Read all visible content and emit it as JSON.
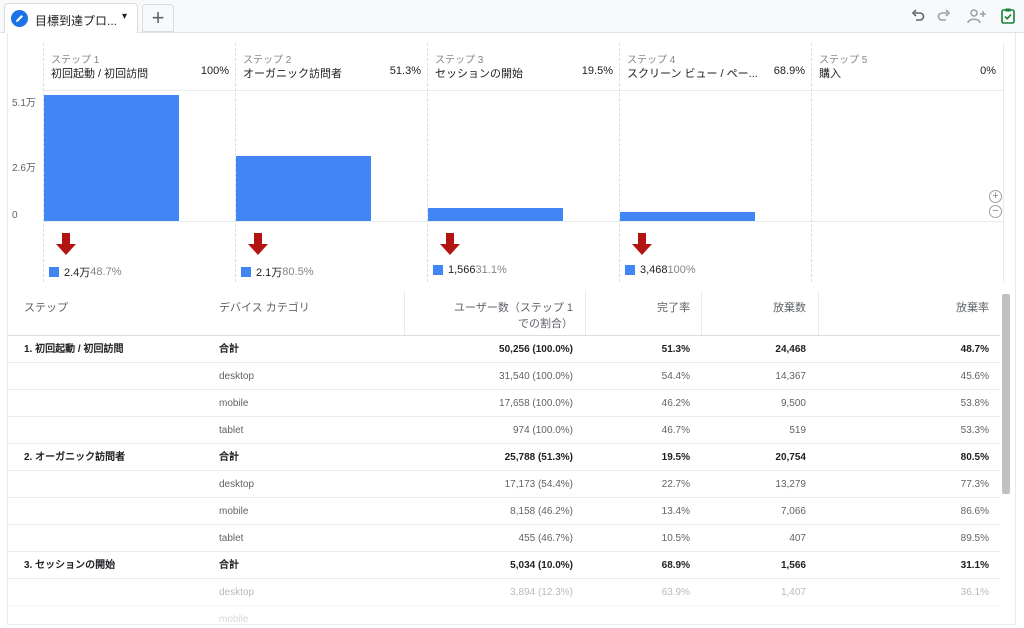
{
  "tab": {
    "title": "目標到達プロ...",
    "caret": "▾",
    "add_label": "+"
  },
  "toolbar_icons": [
    "undo-icon",
    "redo-icon",
    "share-user-icon",
    "saved-check-icon"
  ],
  "chart_data": {
    "type": "bar",
    "y_ticks": [
      "5.1万",
      "2.6万",
      "0"
    ],
    "ylim": [
      0,
      51000
    ],
    "steps": [
      {
        "num": "ステップ 1",
        "name": "初回起動 / 初回訪問",
        "pct": "100%",
        "value": 50256,
        "drop_count": "2.4万",
        "drop_pct": "48.7%"
      },
      {
        "num": "ステップ 2",
        "name": "オーガニック訪問者",
        "pct": "51.3%",
        "value": 25788,
        "drop_count": "2.1万",
        "drop_pct": "80.5%"
      },
      {
        "num": "ステップ 3",
        "name": "セッションの開始",
        "pct": "19.5%",
        "value": 5034,
        "drop_count": "1,566",
        "drop_pct": "31.1%"
      },
      {
        "num": "ステップ 4",
        "name": "スクリーン ビュー / ペー...",
        "pct": "68.9%",
        "value": 3468,
        "drop_count": "3,468",
        "drop_pct": "100%"
      },
      {
        "num": "ステップ 5",
        "name": "購入",
        "pct": "0%",
        "value": 0,
        "drop_count": "",
        "drop_pct": ""
      }
    ],
    "colors": {
      "bar": "#4285f4",
      "arrow": "#b31412"
    }
  },
  "table": {
    "headers": {
      "step": "ステップ",
      "device": "デバイス カテゴリ",
      "users_line1": "ユーザー数（ステップ 1",
      "users_line2": "での割合）",
      "completion": "完了率",
      "abandon": "放棄数",
      "abandon_rate": "放棄率"
    },
    "rows": [
      {
        "step": "1. 初回起動 / 初回訪問",
        "device": "合計",
        "users": "50,256 (100.0%)",
        "completion": "51.3%",
        "abandon": "24,468",
        "abandon_rate": "48.7%",
        "kind": "total"
      },
      {
        "step": "",
        "device": "desktop",
        "users": "31,540 (100.0%)",
        "completion": "54.4%",
        "abandon": "14,367",
        "abandon_rate": "45.6%",
        "kind": "dev"
      },
      {
        "step": "",
        "device": "mobile",
        "users": "17,658 (100.0%)",
        "completion": "46.2%",
        "abandon": "9,500",
        "abandon_rate": "53.8%",
        "kind": "dev"
      },
      {
        "step": "",
        "device": "tablet",
        "users": "974 (100.0%)",
        "completion": "46.7%",
        "abandon": "519",
        "abandon_rate": "53.3%",
        "kind": "dev"
      },
      {
        "step": "2. オーガニック訪問者",
        "device": "合計",
        "users": "25,788 (51.3%)",
        "completion": "19.5%",
        "abandon": "20,754",
        "abandon_rate": "80.5%",
        "kind": "total"
      },
      {
        "step": "",
        "device": "desktop",
        "users": "17,173 (54.4%)",
        "completion": "22.7%",
        "abandon": "13,279",
        "abandon_rate": "77.3%",
        "kind": "dev"
      },
      {
        "step": "",
        "device": "mobile",
        "users": "8,158 (46.2%)",
        "completion": "13.4%",
        "abandon": "7,066",
        "abandon_rate": "86.6%",
        "kind": "dev"
      },
      {
        "step": "",
        "device": "tablet",
        "users": "455 (46.7%)",
        "completion": "10.5%",
        "abandon": "407",
        "abandon_rate": "89.5%",
        "kind": "dev"
      },
      {
        "step": "3. セッションの開始",
        "device": "合計",
        "users": "5,034 (10.0%)",
        "completion": "68.9%",
        "abandon": "1,566",
        "abandon_rate": "31.1%",
        "kind": "total"
      },
      {
        "step": "",
        "device": "desktop",
        "users": "3,894 (12.3%)",
        "completion": "63.9%",
        "abandon": "1,407",
        "abandon_rate": "36.1%",
        "kind": "dev faded"
      },
      {
        "step": "",
        "device": "mobile",
        "users": "",
        "completion": "",
        "abandon": "",
        "abandon_rate": "",
        "kind": "dev faded2"
      }
    ]
  }
}
